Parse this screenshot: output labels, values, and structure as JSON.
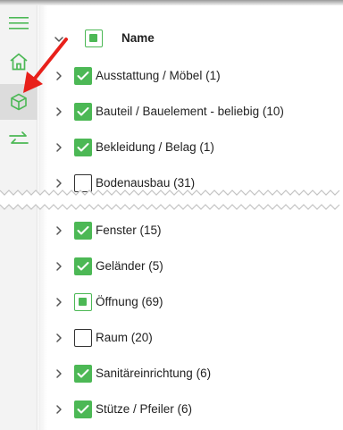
{
  "colors": {
    "accent": "#4cb855",
    "annotation_arrow": "#e8201a"
  },
  "sidebar": {
    "items": [
      {
        "icon": "hamburger-menu-icon"
      },
      {
        "icon": "home-icon"
      },
      {
        "icon": "cube-icon",
        "active": true
      },
      {
        "icon": "swap-arrows-icon"
      }
    ]
  },
  "tree": {
    "header": {
      "label": "Name",
      "check_state": "partial",
      "expand_icon": "chevron-down-icon"
    },
    "rows": [
      {
        "label": "Ausstattung / Möbel (1)",
        "check_state": "checked"
      },
      {
        "label": "Bauteil / Bauelement - beliebig (10)",
        "check_state": "checked"
      },
      {
        "label": "Bekleidung / Belag (1)",
        "check_state": "checked"
      },
      {
        "label": "Bodenausbau (31)",
        "check_state": "unchecked"
      },
      {
        "label": "Fenster (15)",
        "check_state": "checked"
      },
      {
        "label": "Geländer (5)",
        "check_state": "checked"
      },
      {
        "label": "Öffnung (69)",
        "check_state": "partial"
      },
      {
        "label": "Raum (20)",
        "check_state": "unchecked"
      },
      {
        "label": "Sanitäreinrichtung (6)",
        "check_state": "checked"
      },
      {
        "label": "Stütze / Pfeiler (6)",
        "check_state": "checked"
      }
    ]
  }
}
